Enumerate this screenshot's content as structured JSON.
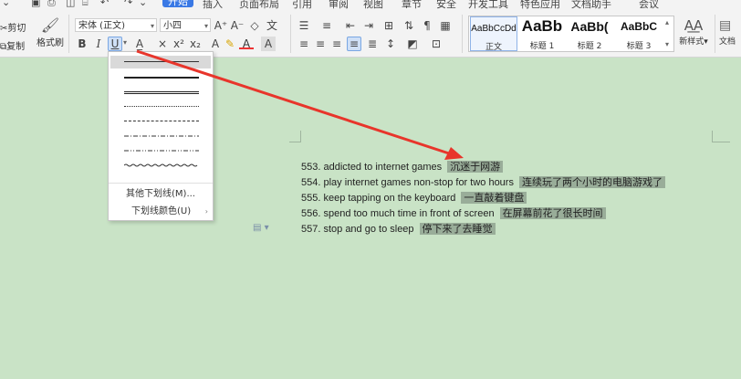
{
  "ribbon": {
    "tabs": [
      "开始",
      "插入",
      "页面布局",
      "引用",
      "审阅",
      "视图",
      "章节",
      "安全",
      "开发工具",
      "特色应用",
      "文档助手",
      "会议"
    ],
    "active_tab": "开始",
    "clipboard": {
      "cut_label": "剪切",
      "copy_label": "复制",
      "format_painter_label": "格式刷"
    },
    "font": {
      "name": "宋体 (正文)",
      "size": "小四"
    },
    "styles": [
      {
        "preview": "AaBbCcDd",
        "label": "正文"
      },
      {
        "preview": "AaBb",
        "label": "标题 1"
      },
      {
        "preview": "AaBb(",
        "label": "标题 2"
      },
      {
        "preview": "AaBbC",
        "label": "标题 3"
      }
    ],
    "new_style_label": "新样式",
    "partial_right_label": "文档"
  },
  "underline_menu": {
    "line_styles": [
      "single",
      "thick",
      "double",
      "dotted",
      "dashed",
      "dash-dot",
      "dash-dot-dot",
      "wavy"
    ],
    "other_label": "其他下划线(M)...",
    "color_label": "下划线颜色(U)"
  },
  "document": {
    "lines": [
      {
        "en": "553. addicted to internet games",
        "zh": "沉迷于网游"
      },
      {
        "en": "554. play internet games non-stop for two hours",
        "zh": "连续玩了两个小时的电脑游戏了"
      },
      {
        "en": "555. keep tapping on the keyboard",
        "zh": "一直敲着键盘"
      },
      {
        "en": "556. spend too much time in front of screen",
        "zh": "在屏幕前花了很长时间"
      },
      {
        "en": "557. stop and go to sleep",
        "zh": "停下来了去睡觉"
      }
    ]
  },
  "colors": {
    "ribbon_bg": "#f3f3f3",
    "doc_bg": "#c9e3c6",
    "highlight": "#99ad99",
    "active_tab": "#3a79e5",
    "arrow": "#e8352b"
  }
}
